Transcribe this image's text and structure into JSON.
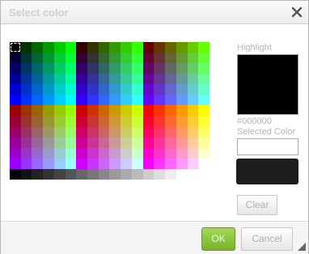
{
  "dialog": {
    "title": "Select color",
    "close_icon": "close-icon"
  },
  "palette": {
    "grid_columns": 18,
    "grid_rows": 12,
    "base_levels": [
      "00",
      "33",
      "66",
      "99",
      "CC",
      "FF"
    ],
    "gray_row": [
      "#000000",
      "#111111",
      "#222222",
      "#333333",
      "#444444",
      "#555555",
      "#666666",
      "#777777",
      "#888888",
      "#999999",
      "#AAAAAA",
      "#BBBBBB",
      "#CCCCCC",
      "#DDDDDD",
      "#EEEEEE",
      "#FFFFFF"
    ],
    "selected": "#000000"
  },
  "side": {
    "highlight_label": "Highlight",
    "highlight_color": "#000000",
    "hex_value": "#000000",
    "selected_label": "Selected Color",
    "selected_color": "#1e1e1e"
  },
  "buttons": {
    "clear": "Clear",
    "ok": "OK",
    "cancel": "Cancel"
  }
}
